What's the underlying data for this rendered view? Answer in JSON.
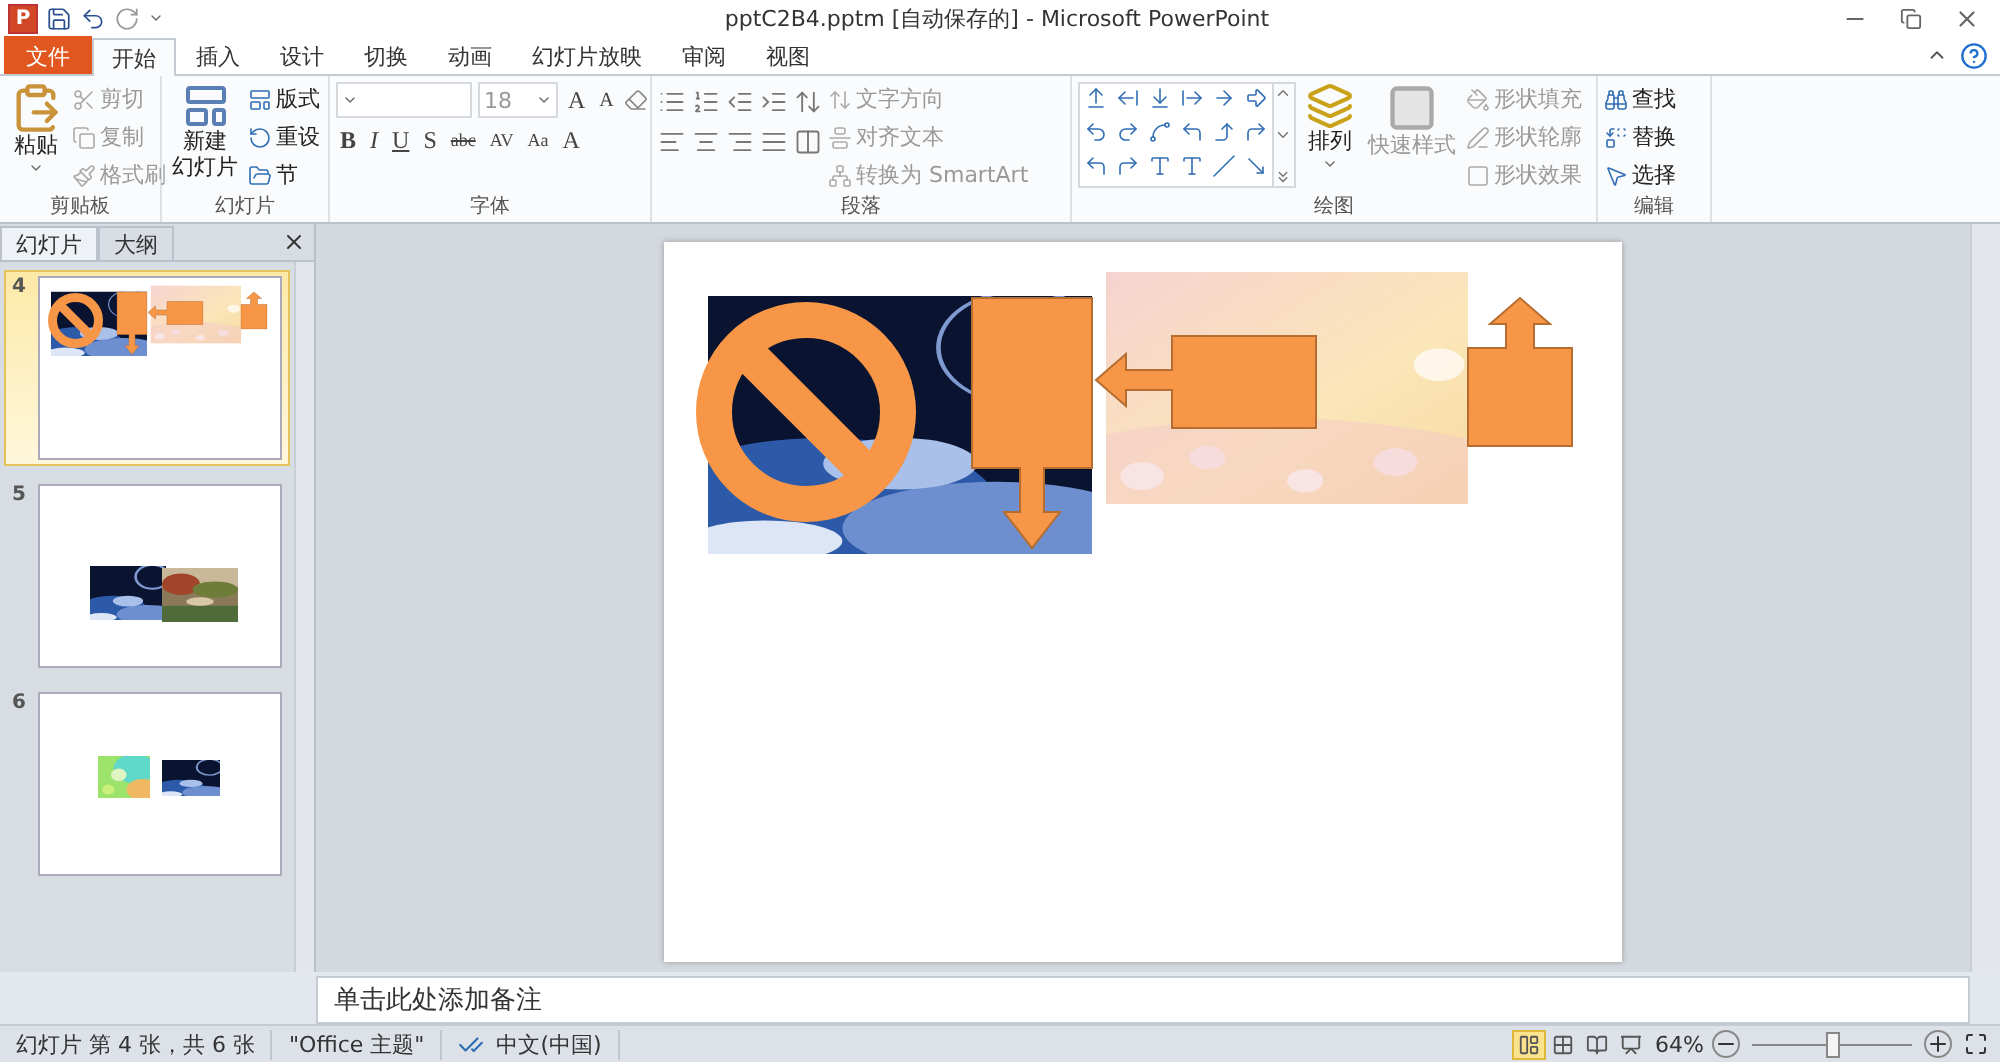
{
  "window": {
    "app_icon": "P",
    "title": "pptC2B4.pptm [自动保存的] - Microsoft PowerPoint"
  },
  "tabs": [
    {
      "label": "文件",
      "kind": "file",
      "selected": false
    },
    {
      "label": "开始",
      "kind": "tab",
      "selected": true
    },
    {
      "label": "插入",
      "kind": "tab",
      "selected": false
    },
    {
      "label": "设计",
      "kind": "tab",
      "selected": false
    },
    {
      "label": "切换",
      "kind": "tab",
      "selected": false
    },
    {
      "label": "动画",
      "kind": "tab",
      "selected": false
    },
    {
      "label": "幻灯片放映",
      "kind": "tab",
      "selected": false
    },
    {
      "label": "审阅",
      "kind": "tab",
      "selected": false
    },
    {
      "label": "视图",
      "kind": "tab",
      "selected": false
    }
  ],
  "ribbon": {
    "clipboard": {
      "title": "剪贴板",
      "paste": "粘贴",
      "items": [
        {
          "label": "剪切",
          "disabled": true
        },
        {
          "label": "复制",
          "disabled": true
        },
        {
          "label": "格式刷",
          "disabled": true
        }
      ]
    },
    "slides": {
      "title": "幻灯片",
      "new_slide": [
        "新建",
        "幻灯片"
      ],
      "items": [
        {
          "label": "版式"
        },
        {
          "label": "重设"
        },
        {
          "label": "节"
        }
      ]
    },
    "font": {
      "title": "字体",
      "size": "18",
      "grow": "A",
      "shrink": "A",
      "formats": [
        "B",
        "I",
        "U",
        "S",
        "abc",
        "AV",
        "Aa"
      ],
      "font_color_label": "A"
    },
    "paragraph": {
      "title": "段落",
      "items": [
        {
          "label": "文字方向",
          "disabled": true
        },
        {
          "label": "对齐文本",
          "disabled": true
        },
        {
          "label": "转换为 SmartArt",
          "disabled": true
        }
      ]
    },
    "drawing": {
      "title": "绘图",
      "arrange": "排列",
      "quick_styles": {
        "label": "快速样式",
        "disabled": true
      },
      "items": [
        {
          "label": "形状填充",
          "disabled": true
        },
        {
          "label": "形状轮廓",
          "disabled": true
        },
        {
          "label": "形状效果",
          "disabled": true
        }
      ]
    },
    "editing": {
      "title": "编辑",
      "items": [
        {
          "label": "查找"
        },
        {
          "label": "替换"
        },
        {
          "label": "选择"
        }
      ]
    }
  },
  "slides_panel": {
    "tabs": [
      {
        "label": "幻灯片",
        "selected": true
      },
      {
        "label": "大纲",
        "selected": false
      }
    ],
    "slides": [
      {
        "number": "4",
        "selected": true
      },
      {
        "number": "5",
        "selected": false
      },
      {
        "number": "6",
        "selected": false
      }
    ]
  },
  "notes": {
    "placeholder": "单击此处添加备注"
  },
  "status_bar": {
    "slide_info": "幻灯片 第 4 张，共 6 张",
    "theme": "\"Office 主题\"",
    "language": "中文(中国)",
    "views": [
      {
        "selected": true
      },
      {
        "selected": false
      },
      {
        "selected": false
      },
      {
        "selected": false
      }
    ],
    "zoom": "64%",
    "zoom_slider": {
      "level": 0.5
    }
  }
}
